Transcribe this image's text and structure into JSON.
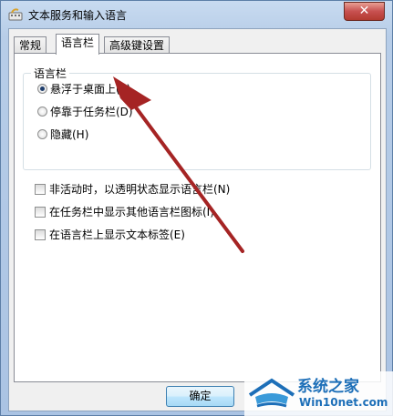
{
  "window": {
    "title": "文本服务和输入语言",
    "close_symbol": "✕"
  },
  "tabs": [
    {
      "label": "常规",
      "active": false
    },
    {
      "label": "语言栏",
      "active": true
    },
    {
      "label": "高级键设置",
      "active": false
    }
  ],
  "language_bar_group": {
    "title": "语言栏",
    "options": [
      {
        "label": "悬浮于桌面上(F)",
        "checked": true
      },
      {
        "label": "停靠于任务栏(D)",
        "checked": false
      },
      {
        "label": "隐藏(H)",
        "checked": false
      }
    ]
  },
  "checkboxes": [
    {
      "label": "非活动时，以透明状态显示语言栏(N)",
      "checked": false
    },
    {
      "label": "在任务栏中显示其他语言栏图标(I)",
      "checked": false
    },
    {
      "label": "在语言栏上显示文本标签(E)",
      "checked": false
    }
  ],
  "buttons": {
    "ok": "确定"
  },
  "watermark": {
    "title": "系统之家",
    "url": "Win10net.com"
  },
  "colors": {
    "arrow": "#a52424",
    "accent": "#1d6fb8"
  }
}
